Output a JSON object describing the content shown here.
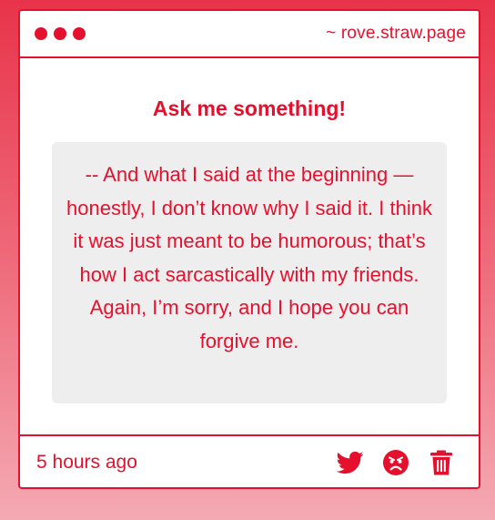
{
  "header": {
    "site": "~ rove.straw.page"
  },
  "content": {
    "title": "Ask me something!",
    "message": "-- And what I said at the beginning —honestly, I don’t know why I said it. I think it was just meant to be humorous; that’s how I act sarcastically with my friends. Again, I’m sorry, and I hope you can forgive me."
  },
  "footer": {
    "timestamp": "5 hours ago"
  },
  "icons": {
    "share": "twitter-icon",
    "react": "angry-face-icon",
    "delete": "trash-icon"
  },
  "colors": {
    "accent": "#e5102d",
    "message_bg": "#efeeef",
    "card_bg": "#ffffff"
  }
}
